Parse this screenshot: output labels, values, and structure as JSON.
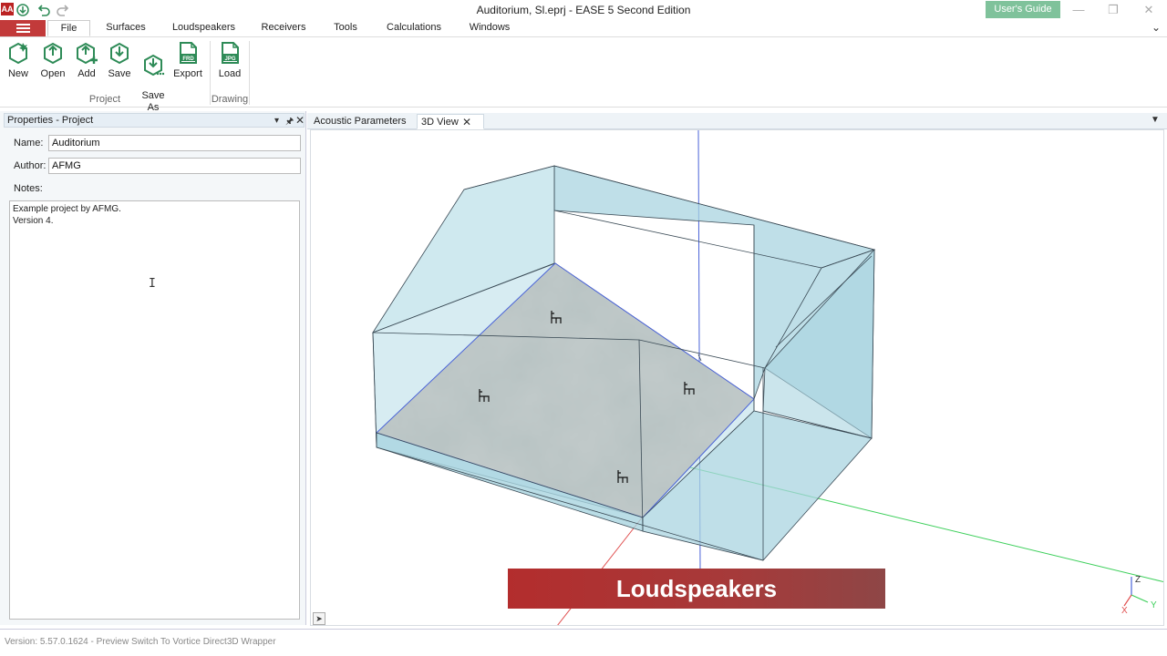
{
  "titlebar": {
    "title": "Auditorium, Sl.eprj - EASE 5 Second Edition",
    "logo_text": "AA",
    "users_guide": "User's Guide",
    "quick_access": [
      "save-icon",
      "undo-icon",
      "redo-icon"
    ]
  },
  "menu": {
    "tabs": [
      "File",
      "Surfaces",
      "Loudspeakers",
      "Receivers",
      "Tools",
      "Calculations",
      "Windows"
    ]
  },
  "ribbon": {
    "buttons": [
      "New",
      "Open",
      "Add",
      "Save",
      "Save\nAs",
      "Export",
      "Load"
    ],
    "export_badge": "FRD",
    "load_badge": "JPG",
    "groups": [
      "Project",
      "Drawing"
    ],
    "accent_color": "#2e8b57"
  },
  "properties": {
    "title": "Properties - Project",
    "name_label": "Name:",
    "name_value": "Auditorium",
    "author_label": "Author:",
    "author_value": "AFMG",
    "notes_label": "Notes:",
    "notes_value": "Example project by AFMG.\nVersion 4."
  },
  "document": {
    "tabs": [
      "Acoustic Parameters",
      "3D View"
    ],
    "overlay_text": "Loudspeakers",
    "axes": [
      "Z",
      "X",
      "Y"
    ]
  },
  "status": {
    "text": "Version: 5.57.0.1624 - Preview Switch To Vortice Direct3D Wrapper"
  }
}
